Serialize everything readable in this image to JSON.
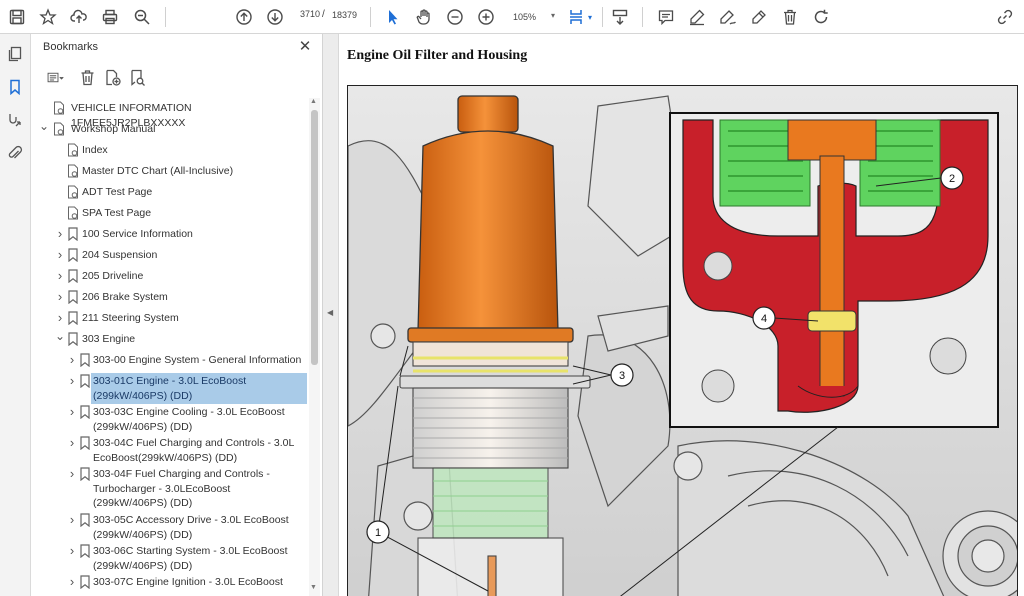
{
  "toolbar": {
    "page_current": "3710",
    "page_separator": "/",
    "page_total": "18379",
    "zoom": "105%",
    "icons": [
      "save-icon",
      "bookmark-star-icon",
      "upload-icon",
      "print-icon",
      "zoom-search-icon",
      "page-up-icon",
      "page-down-icon",
      "select-cursor-icon",
      "hand-icon",
      "zoom-out-icon",
      "zoom-in-icon",
      "fit-page-icon",
      "scroll-mode-icon",
      "comment-icon",
      "highlight-pen-icon",
      "draw-icon",
      "sign-icon",
      "delete-icon",
      "rotate-icon",
      "share-link-icon"
    ]
  },
  "rail": {
    "items": [
      "page-thumbnails-icon",
      "bookmarks-icon",
      "links-icon",
      "attachments-icon"
    ],
    "active_color": "#1f6fd6"
  },
  "bookmarks": {
    "title": "Bookmarks",
    "close": "✕",
    "items": [
      {
        "label": "VEHICLE INFORMATION 1FMEE5JR2PLBXXXXX",
        "level": 0,
        "expander": "",
        "doc_icon": true
      },
      {
        "label": "Workshop Manual",
        "level": 0,
        "expander": "expanded",
        "doc_icon": true
      },
      {
        "label": "Index",
        "level": 1,
        "expander": "",
        "doc_icon": true
      },
      {
        "label": "Master DTC Chart (All-Inclusive)",
        "level": 1,
        "expander": "",
        "doc_icon": true
      },
      {
        "label": "ADT Test Page",
        "level": 1,
        "expander": "",
        "doc_icon": true
      },
      {
        "label": "SPA Test Page",
        "level": 1,
        "expander": "",
        "doc_icon": true
      },
      {
        "label": "100 Service Information",
        "level": 1,
        "expander": "collapsed"
      },
      {
        "label": "204 Suspension",
        "level": 1,
        "expander": "collapsed"
      },
      {
        "label": "205 Driveline",
        "level": 1,
        "expander": "collapsed"
      },
      {
        "label": "206 Brake System",
        "level": 1,
        "expander": "collapsed"
      },
      {
        "label": "211 Steering System",
        "level": 1,
        "expander": "collapsed"
      },
      {
        "label": "303 Engine",
        "level": 1,
        "expander": "expanded"
      },
      {
        "label": "303-00 Engine System - General Information",
        "level": 2,
        "expander": "collapsed"
      },
      {
        "label": "303-01C Engine - 3.0L EcoBoost (299kW/406PS) (DD)",
        "level": 2,
        "expander": "collapsed",
        "selected": true
      },
      {
        "label": "303-03C Engine Cooling - 3.0L EcoBoost (299kW/406PS) (DD)",
        "level": 2,
        "expander": "collapsed"
      },
      {
        "label": "303-04C Fuel Charging and Controls - 3.0L EcoBoost(299kW/406PS) (DD)",
        "level": 2,
        "expander": "collapsed"
      },
      {
        "label": "303-04F Fuel Charging and Controls - Turbocharger - 3.0LEcoBoost (299kW/406PS) (DD)",
        "level": 2,
        "expander": "collapsed"
      },
      {
        "label": "303-05C Accessory Drive - 3.0L EcoBoost (299kW/406PS) (DD)",
        "level": 2,
        "expander": "collapsed"
      },
      {
        "label": "303-06C Starting System - 3.0L EcoBoost (299kW/406PS) (DD)",
        "level": 2,
        "expander": "collapsed"
      },
      {
        "label": "303-07C Engine Ignition - 3.0L EcoBoost",
        "level": 2,
        "expander": "collapsed"
      }
    ]
  },
  "document": {
    "title": "Engine Oil Filter and Housing",
    "callouts": [
      "1",
      "2",
      "3",
      "4"
    ],
    "colors": {
      "housing": "#e9791f",
      "filter_green": "#5fd35f",
      "seal_red": "#c8202a",
      "seal_yellow": "#f2e26a"
    }
  }
}
